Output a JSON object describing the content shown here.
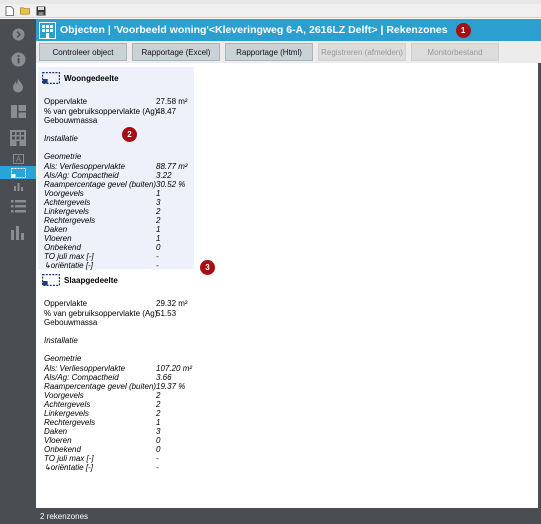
{
  "header": {
    "title": "Objecten | 'Voorbeeld woning'<Kleveringweg 6-A, 2616LZ Delft> | Rekenzones",
    "badge": "1"
  },
  "buttons": [
    {
      "label": "Controleer object",
      "enabled": true
    },
    {
      "label": "Rapportage (Excel)",
      "enabled": true
    },
    {
      "label": "Rapportage (Html)",
      "enabled": true
    },
    {
      "label": "Registreren (afmelden)",
      "enabled": false
    },
    {
      "label": "Monitorbestand",
      "enabled": false
    }
  ],
  "badges": {
    "two": "2",
    "three": "3"
  },
  "zones": [
    {
      "title": "Woongedeelte",
      "rows": [
        {
          "k": "Oppervlakte",
          "v": "27.58 m²"
        },
        {
          "k": "% van gebruiksoppervlakte (Ag)",
          "v": "48.47"
        },
        {
          "k": "Gebouwmassa",
          "v": ""
        },
        {
          "k": "Installatie",
          "v": "",
          "italic": true
        },
        {
          "k": "Geometrie",
          "v": "",
          "italic": true
        },
        {
          "k": "Als: Verliesoppervlakte",
          "v": "88.77 m²",
          "italic": true
        },
        {
          "k": "Als/Ag: Compactheid",
          "v": "3.22",
          "italic": true
        },
        {
          "k": "Raampercentage gevel (buiten)",
          "v": "30.52 %",
          "italic": true
        },
        {
          "k": "Voorgevels",
          "v": "1",
          "italic": true
        },
        {
          "k": "Achtergevels",
          "v": "3",
          "italic": true
        },
        {
          "k": "Linkergevels",
          "v": "2",
          "italic": true
        },
        {
          "k": "Rechtergevels",
          "v": "2",
          "italic": true
        },
        {
          "k": "Daken",
          "v": "1",
          "italic": true
        },
        {
          "k": "Vloeren",
          "v": "1",
          "italic": true
        },
        {
          "k": "Onbekend",
          "v": "0",
          "italic": true
        },
        {
          "k": "TO juli max [-]",
          "v": "-",
          "italic": true
        },
        {
          "k": "↳oriëntatie [-]",
          "v": "-",
          "italic": true
        }
      ]
    },
    {
      "title": "Slaapgedeelte",
      "rows": [
        {
          "k": "Oppervlakte",
          "v": "29.32 m²"
        },
        {
          "k": "% van gebruiksoppervlakte (Ag)",
          "v": "51.53"
        },
        {
          "k": "Gebouwmassa",
          "v": ""
        },
        {
          "k": "Installatie",
          "v": "",
          "italic": true
        },
        {
          "k": "Geometrie",
          "v": "",
          "italic": true
        },
        {
          "k": "Als: Verliesoppervlakte",
          "v": "107.20 m²",
          "italic": true
        },
        {
          "k": "Als/Ag: Compactheid",
          "v": "3.66",
          "italic": true
        },
        {
          "k": "Raampercentage gevel (buiten)",
          "v": "19.37 %",
          "italic": true
        },
        {
          "k": "Voorgevels",
          "v": "2",
          "italic": true
        },
        {
          "k": "Achtergevels",
          "v": "2",
          "italic": true
        },
        {
          "k": "Linkergevels",
          "v": "2",
          "italic": true
        },
        {
          "k": "Rechtergevels",
          "v": "1",
          "italic": true
        },
        {
          "k": "Daken",
          "v": "3",
          "italic": true
        },
        {
          "k": "Vloeren",
          "v": "0",
          "italic": true
        },
        {
          "k": "Onbekend",
          "v": "0",
          "italic": true
        },
        {
          "k": "TO juli max [-]",
          "v": "-",
          "italic": true
        },
        {
          "k": "↳oriëntatie [-]",
          "v": "-",
          "italic": true
        }
      ]
    }
  ],
  "status": "2 rekenzones",
  "colors": {
    "accent": "#2c9fd1",
    "rail": "#4a4d52",
    "badge": "#a50f14",
    "zone_bg": "#eef0fa"
  }
}
